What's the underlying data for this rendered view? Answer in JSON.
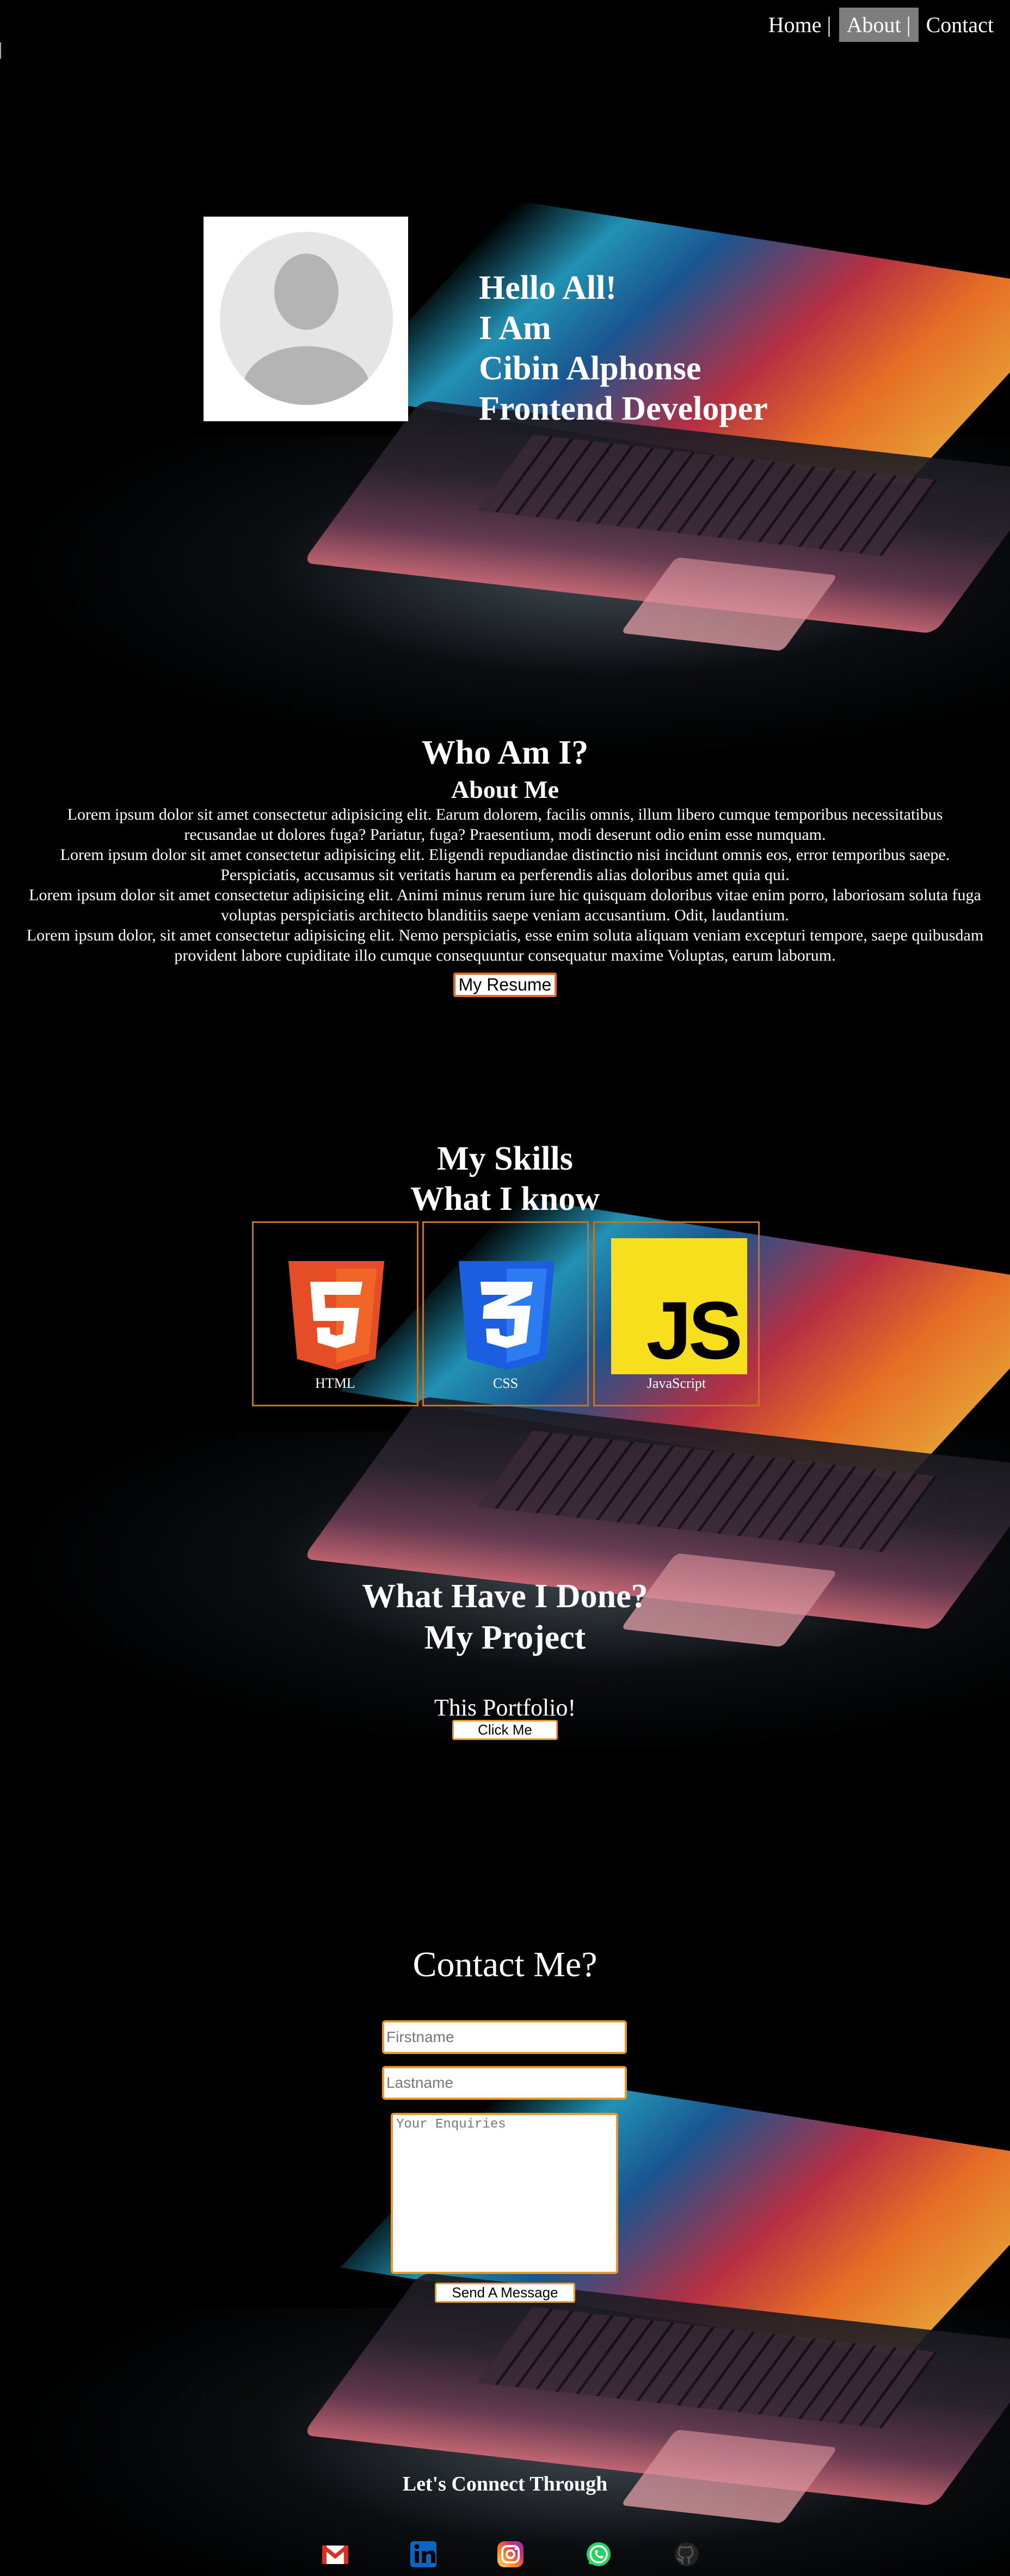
{
  "nav": {
    "items": [
      {
        "label": "Home |"
      },
      {
        "label": "About |"
      },
      {
        "label": "Contact"
      }
    ],
    "active_index": 1
  },
  "hero": {
    "lines": [
      "Hello All!",
      "I Am",
      "Cibin Alphonse",
      "Frontend Developer"
    ]
  },
  "about": {
    "title": "Who Am I?",
    "subtitle": "About Me",
    "paragraphs": [
      "Lorem ipsum dolor sit amet consectetur adipisicing elit. Earum dolorem, facilis omnis, illum libero cumque temporibus necessitatibus recusandae ut dolores fuga? Pariatur, fuga? Praesentium, modi deserunt odio enim esse numquam.",
      "Lorem ipsum dolor sit amet consectetur adipisicing elit. Eligendi repudiandae distinctio nisi incidunt omnis eos, error temporibus saepe. Perspiciatis, accusamus sit veritatis harum ea perferendis alias doloribus amet quia qui.",
      "Lorem ipsum dolor sit amet consectetur adipisicing elit. Animi minus rerum iure hic quisquam doloribus vitae enim porro, laboriosam soluta fuga voluptas perspiciatis architecto blanditiis saepe veniam accusantium. Odit, laudantium.",
      "Lorem ipsum dolor, sit amet consectetur adipisicing elit. Nemo perspiciatis, esse enim soluta aliquam veniam excepturi tempore, saepe quibusdam provident labore cupiditate illo cumque consequuntur consequatur maxime Voluptas, earum laborum."
    ],
    "resume_button": "My Resume"
  },
  "skills": {
    "title": "My Skills",
    "subtitle": "What I know",
    "items": [
      {
        "name": "HTML",
        "icon": "html5-icon",
        "color": "#e44d26"
      },
      {
        "name": "CSS",
        "icon": "css3-icon",
        "color": "#1b5fe0"
      },
      {
        "name": "JavaScript",
        "icon": "javascript-icon",
        "color": "#f7df1e"
      }
    ]
  },
  "projects": {
    "title": "What Have I Done?",
    "subtitle": "My Project",
    "project_name": "This Portfolio!",
    "button": "Click Me"
  },
  "contact": {
    "title": "Contact Me?",
    "firstname_placeholder": "Firstname",
    "lastname_placeholder": "Lastname",
    "message_placeholder": "Your Enquiries",
    "submit": "Send A Message"
  },
  "connect": {
    "title": "Let's Connect Through",
    "icons": [
      "gmail-icon",
      "linkedin-icon",
      "instagram-icon",
      "whatsapp-icon",
      "github-icon"
    ]
  },
  "colors": {
    "accent_border": "#e59b2a",
    "nav_active_bg": "#7d7d7d"
  }
}
